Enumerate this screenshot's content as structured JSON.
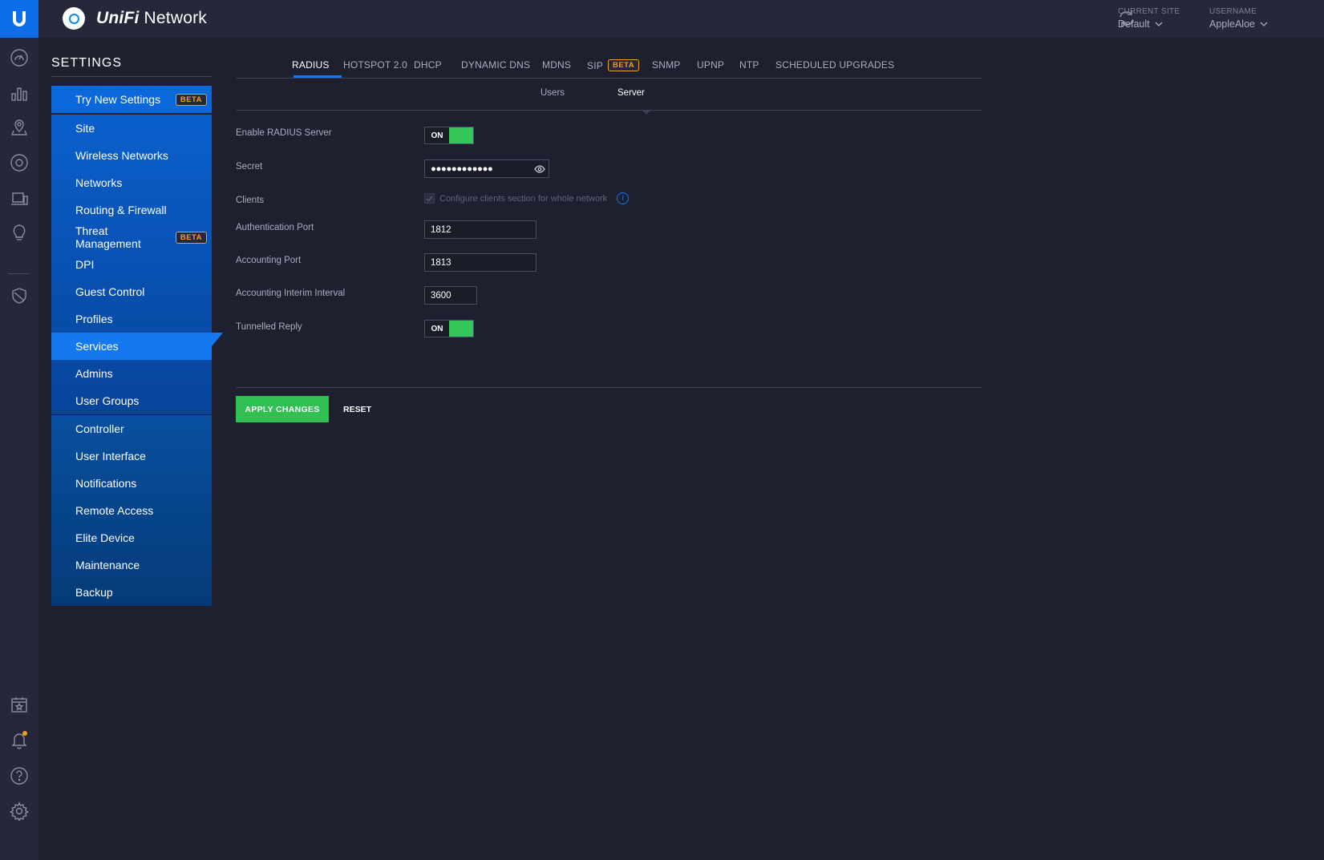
{
  "app": {
    "brand_prefix": "UniFi",
    "brand_suffix": "Network"
  },
  "header": {
    "current_site_label": "CURRENT SITE",
    "current_site_value": "Default",
    "username_label": "USERNAME",
    "username_value": "AppleAloe"
  },
  "rail_icons": [
    "dashboard-icon",
    "statistics-icon",
    "map-icon",
    "devices-icon",
    "clients-icon",
    "insights-icon",
    "threat-shield-icon",
    "events-calendar-icon",
    "alerts-bell-icon",
    "help-icon",
    "settings-gear-icon"
  ],
  "settings": {
    "title": "SETTINGS",
    "try_new": {
      "label": "Try New Settings",
      "badge": "BETA"
    },
    "group1": [
      {
        "label": "Site"
      },
      {
        "label": "Wireless Networks"
      },
      {
        "label": "Networks"
      },
      {
        "label": "Routing & Firewall"
      },
      {
        "label": "Threat Management",
        "badge": "BETA"
      },
      {
        "label": "DPI"
      },
      {
        "label": "Guest Control"
      },
      {
        "label": "Profiles"
      },
      {
        "label": "Services",
        "active": true
      },
      {
        "label": "Admins"
      },
      {
        "label": "User Groups"
      }
    ],
    "group2": [
      {
        "label": "Controller"
      },
      {
        "label": "User Interface"
      },
      {
        "label": "Notifications"
      },
      {
        "label": "Remote Access"
      },
      {
        "label": "Elite Device"
      },
      {
        "label": "Maintenance"
      },
      {
        "label": "Backup"
      }
    ]
  },
  "tabs": [
    {
      "label": "RADIUS",
      "active": true
    },
    {
      "label": "HOTSPOT 2.0"
    },
    {
      "label": "DHCP"
    },
    {
      "label": "DYNAMIC DNS"
    },
    {
      "label": "MDNS"
    },
    {
      "label": "SIP",
      "badge": "BETA"
    },
    {
      "label": "SNMP"
    },
    {
      "label": "UPNP"
    },
    {
      "label": "NTP"
    },
    {
      "label": "SCHEDULED UPGRADES"
    }
  ],
  "subtabs": [
    {
      "label": "Users"
    },
    {
      "label": "Server",
      "active": true
    }
  ],
  "form": {
    "enable_radius_label": "Enable RADIUS Server",
    "enable_radius_state": "ON",
    "secret_label": "Secret",
    "secret_value": "●●●●●●●●●●●●",
    "clients_label": "Clients",
    "clients_checkbox_text": "Configure clients section for whole network",
    "auth_port_label": "Authentication Port",
    "auth_port_value": "1812",
    "acct_port_label": "Accounting Port",
    "acct_port_value": "1813",
    "acct_interim_label": "Accounting Interim Interval",
    "acct_interim_value": "3600",
    "tunnelled_label": "Tunnelled Reply",
    "tunnelled_state": "ON"
  },
  "actions": {
    "apply": "APPLY CHANGES",
    "reset": "RESET"
  },
  "colors": {
    "accent": "#1479f0",
    "success": "#2fbf52",
    "beta": "#f0a020",
    "background": "#1e2030"
  }
}
